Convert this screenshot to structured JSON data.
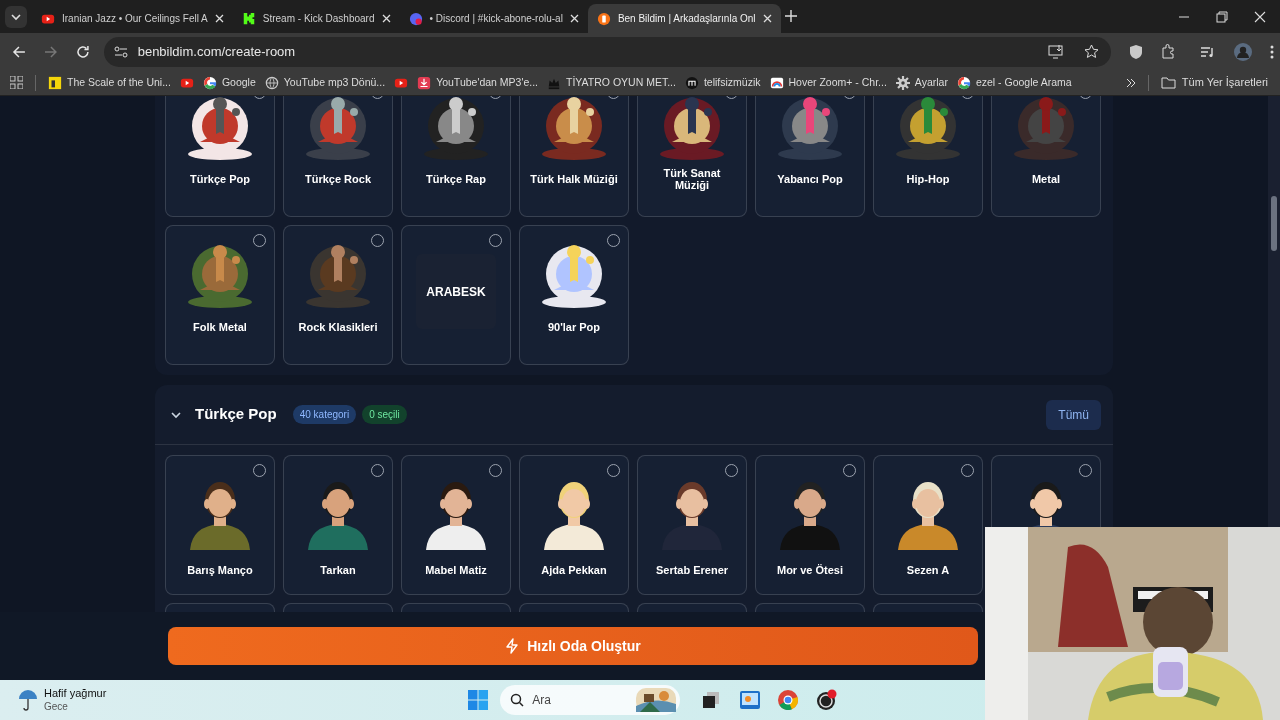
{
  "browser": {
    "tabs": [
      {
        "title": "Iranian Jazz • Our Ceilings Fell A",
        "kind": "video",
        "selected": false
      },
      {
        "title": "Stream - Kick Dashboard",
        "kind": "kick",
        "selected": false
      },
      {
        "title": "• Discord | #kick-abone-rolu-al",
        "kind": "discord",
        "selected": false
      },
      {
        "title": "Ben Bildim | Arkadaşlarınla Onl",
        "kind": "site",
        "selected": true
      }
    ],
    "address": "benbildim.com/create-room",
    "bookmarks": [
      {
        "label": "The Scale of the Uni...",
        "kind": "note"
      },
      {
        "kind": "video"
      },
      {
        "label": "Google",
        "kind": "google"
      },
      {
        "label": "YouTube mp3 Dönü...",
        "kind": "globe"
      },
      {
        "kind": "video"
      },
      {
        "label": "YouTube'dan MP3'e...",
        "kind": "download"
      },
      {
        "label": "TİYATRO OYUN MET...",
        "kind": "crown"
      },
      {
        "label": "telifsizmüzik",
        "kind": "letter"
      },
      {
        "label": "Hover Zoom+ - Chr...",
        "kind": "rainbow"
      },
      {
        "label": "Ayarlar",
        "kind": "gear"
      },
      {
        "label": "ezel - Google Arama",
        "kind": "google"
      }
    ],
    "all_bookmarks": "Tüm Yer İşaretleri"
  },
  "genres": [
    {
      "label": "Türkçe Pop",
      "kind": "picture",
      "selected": false
    },
    {
      "label": "Türkçe Rock",
      "kind": "picture",
      "selected": false
    },
    {
      "label": "Türkçe Rap",
      "kind": "picture",
      "selected": false
    },
    {
      "label": "Türk Halk Müziği",
      "kind": "picture",
      "selected": false
    },
    {
      "label": "Türk Sanat Müziği",
      "kind": "picture",
      "selected": false
    },
    {
      "label": "Yabancı Pop",
      "kind": "picture",
      "selected": false
    },
    {
      "label": "Hip-Hop",
      "kind": "picture",
      "selected": false
    },
    {
      "label": "Metal",
      "kind": "picture",
      "selected": false
    },
    {
      "label": "Folk Metal",
      "kind": "picture",
      "selected": false
    },
    {
      "label": "Rock Klasikleri",
      "kind": "picture",
      "selected": false
    },
    {
      "tile_text": "ARABESK",
      "kind": "text_tile",
      "selected": false
    },
    {
      "label": "90'lar Pop",
      "kind": "picture",
      "selected": false
    }
  ],
  "section": {
    "title": "Türkçe Pop",
    "expanded": true,
    "count_badge": "40 kategori",
    "selected_badge": "0 seçili",
    "all_button": "Tümü"
  },
  "artists": [
    {
      "label": "Barış Manço",
      "selected": false
    },
    {
      "label": "Tarkan",
      "selected": false
    },
    {
      "label": "Mabel Matiz",
      "selected": false
    },
    {
      "label": "Ajda Pekkan",
      "selected": false
    },
    {
      "label": "Sertab Erener",
      "selected": false
    },
    {
      "label": "Mor ve Ötesi",
      "selected": false
    },
    {
      "label": "Sezen A",
      "selected": false
    },
    {
      "selected": false
    }
  ],
  "cta": "Hızlı Oda Oluştur",
  "taskbar": {
    "weather": "Hafif yağmur",
    "weather_sub": "Gece",
    "search_placeholder": "Ara"
  }
}
